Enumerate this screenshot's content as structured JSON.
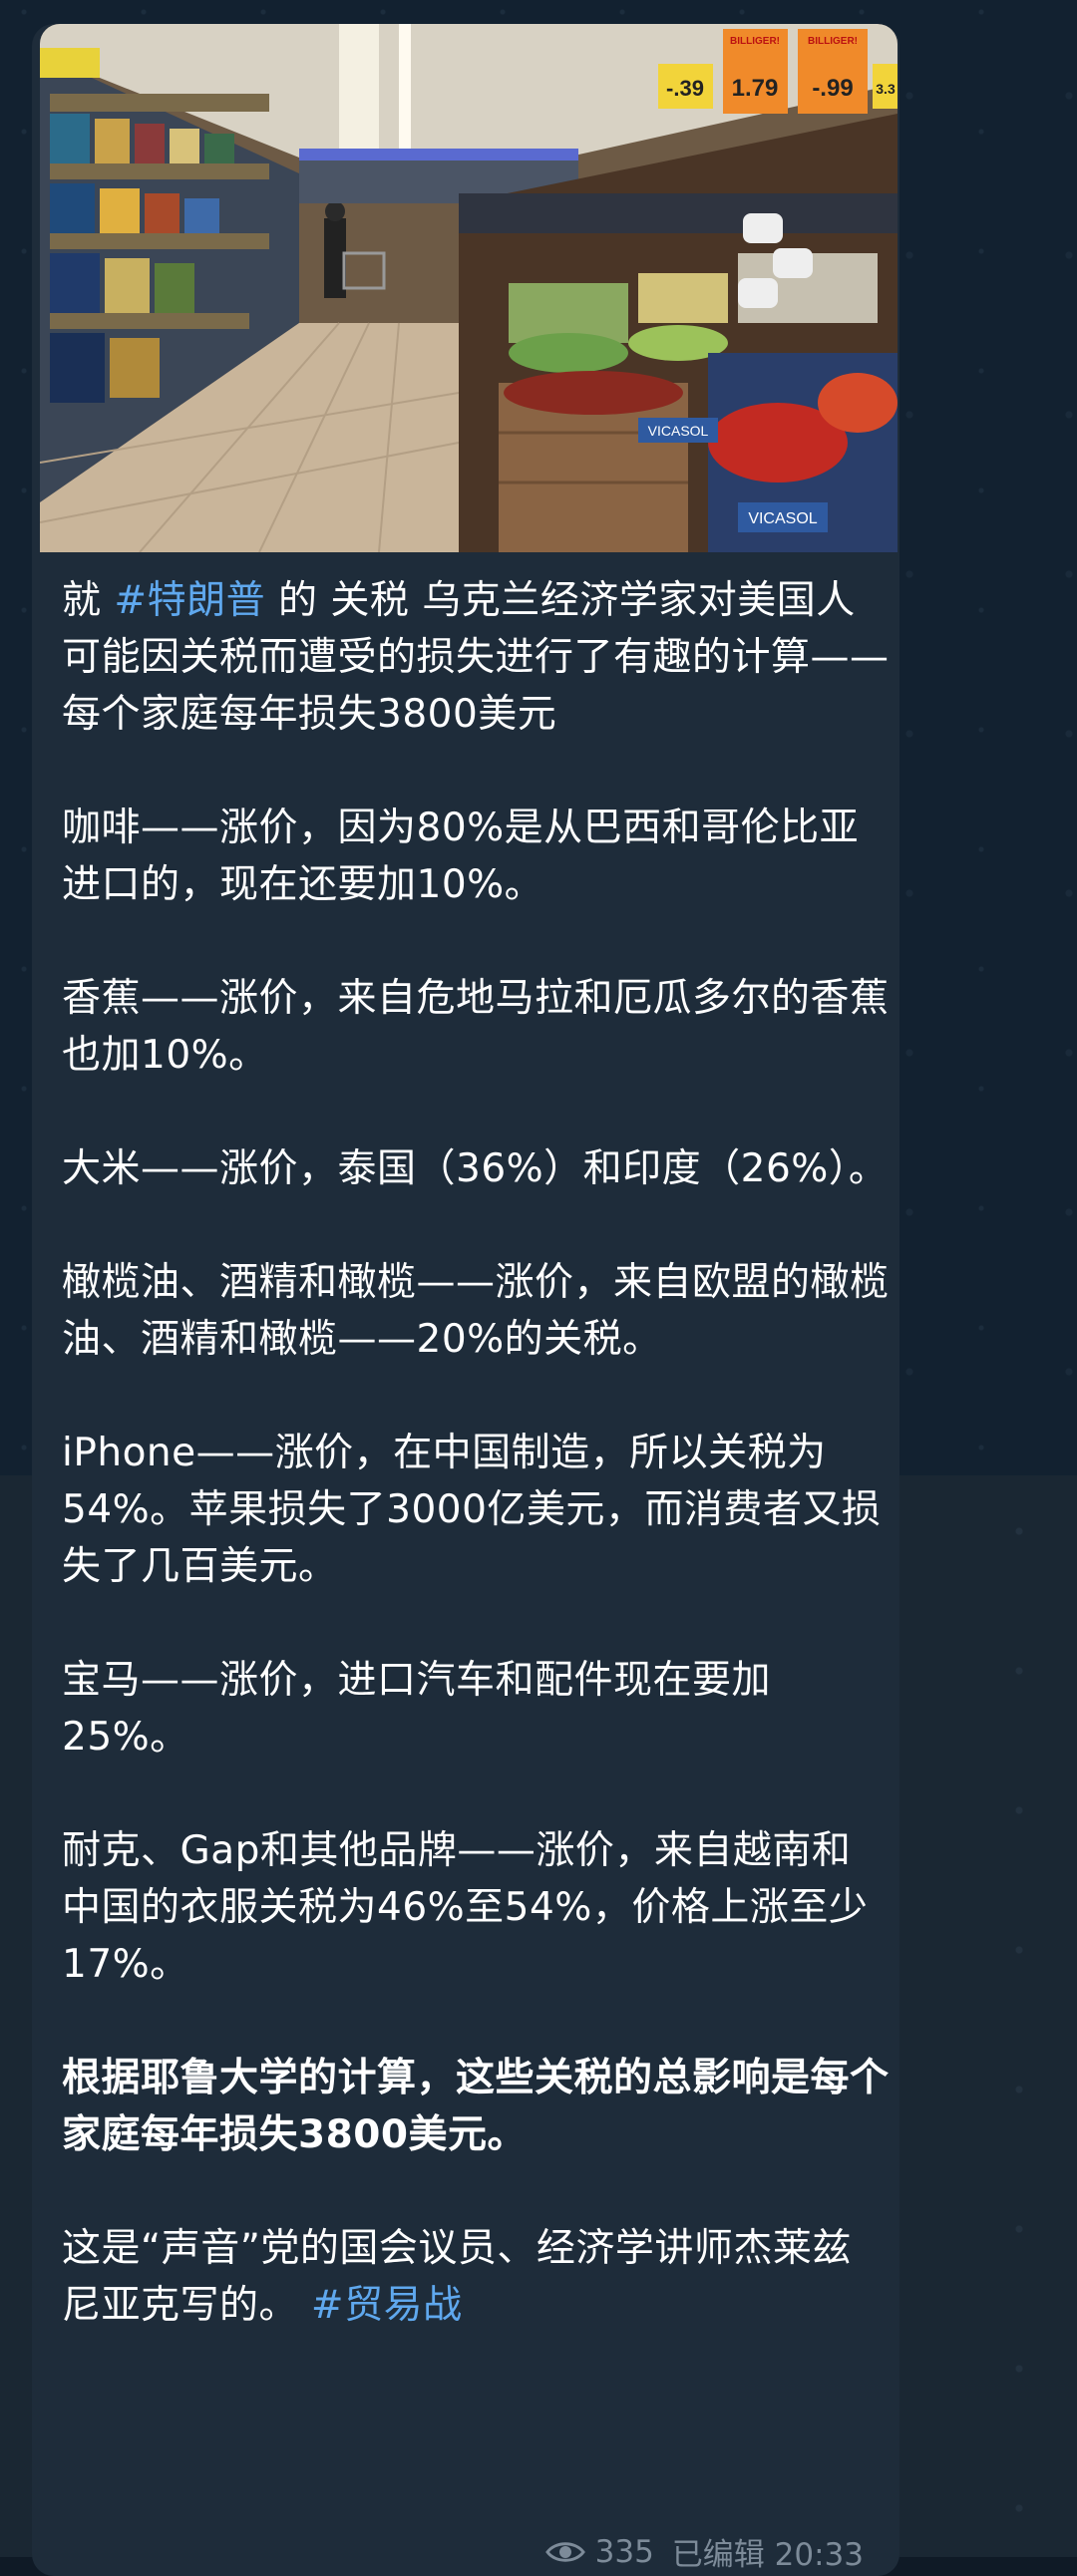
{
  "message": {
    "intro": {
      "prefix": "就 ",
      "hashtag": "#特朗普",
      "suffix": " 的 关税 乌克兰经济学家对美国人可能因关税而遭受的损失进行了有趣的计算——每个家庭每年损失3800美元"
    },
    "paragraphs": [
      "咖啡——涨价，因为80%是从巴西和哥伦比亚进口的，现在还要加10%。",
      "香蕉——涨价，来自危地马拉和厄瓜多尔的香蕉也加10%。",
      "大米——涨价，泰国（36%）和印度（26%）。",
      "橄榄油、酒精和橄榄——涨价，来自欧盟的橄榄油、酒精和橄榄——20%的关税。",
      "iPhone——涨价，在中国制造，所以关税为54%。苹果损失了3000亿美元，而消费者又损失了几百美元。",
      "宝马——涨价，进口汽车和配件现在要加25%。",
      "耐克、Gap和其他品牌——涨价，来自越南和中国的衣服关税为46%至54%，价格上涨至少17%。"
    ],
    "bold_paragraph": "根据耶鲁大学的计算，这些关税的总影响是每个家庭每年损失3800美元。",
    "outro": {
      "text": "这是“声音”党的国会议员、经济学讲师杰莱兹尼亚克写的。 ",
      "hashtag": "#贸易战"
    }
  },
  "photo": {
    "price_tags": [
      "BILLIGER!",
      "1.79",
      "-.99",
      "-.39",
      "3.3",
      "VICASOL",
      "VICASOL"
    ]
  },
  "meta": {
    "views": "335",
    "status": "已编辑 20:33"
  },
  "colors": {
    "bubble": "#1e2c3a",
    "hashtag": "#5fa8ee",
    "meta": "#7d8b99"
  }
}
